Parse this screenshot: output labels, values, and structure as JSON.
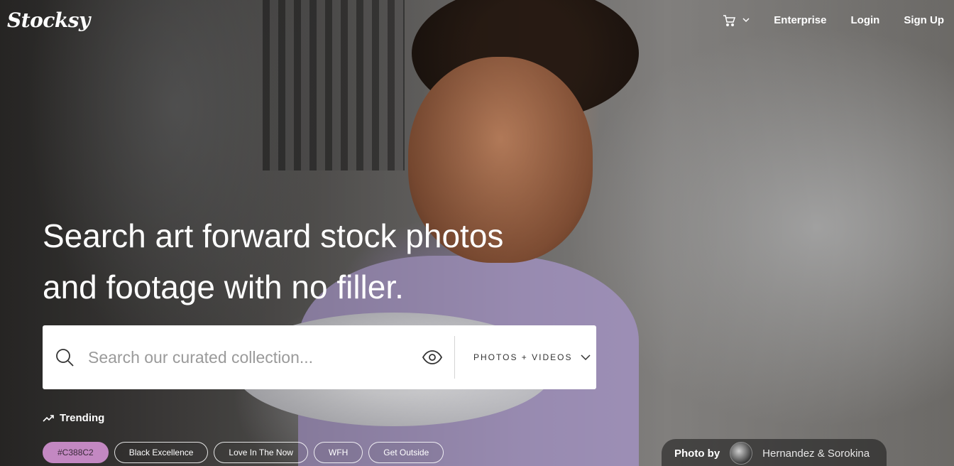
{
  "header": {
    "logo": "Stocksy",
    "nav": {
      "enterprise": "Enterprise",
      "login": "Login",
      "signup": "Sign Up"
    }
  },
  "hero": {
    "headline_line1": "Search art forward stock photos",
    "headline_line2": "and footage with no filler."
  },
  "search": {
    "placeholder": "Search our curated collection...",
    "type_selected": "PHOTOS + VIDEOS"
  },
  "trending": {
    "label": "Trending",
    "chips": [
      {
        "label": "#C388C2",
        "color": "#C388C2"
      },
      {
        "label": "Black Excellence"
      },
      {
        "label": "Love In The Now"
      },
      {
        "label": "WFH"
      },
      {
        "label": "Get Outside"
      }
    ]
  },
  "credit": {
    "label": "Photo by",
    "photographer": "Hernandez & Sorokina"
  },
  "icons": {
    "cart": "cart-icon",
    "search": "search-icon",
    "visual_search": "eye-icon",
    "dropdown": "chevron-down-icon",
    "trending": "trending-up-icon"
  },
  "colors": {
    "chip_accent": "#c388c2",
    "text_on_hero": "#ffffff",
    "search_bg": "#ffffff"
  }
}
